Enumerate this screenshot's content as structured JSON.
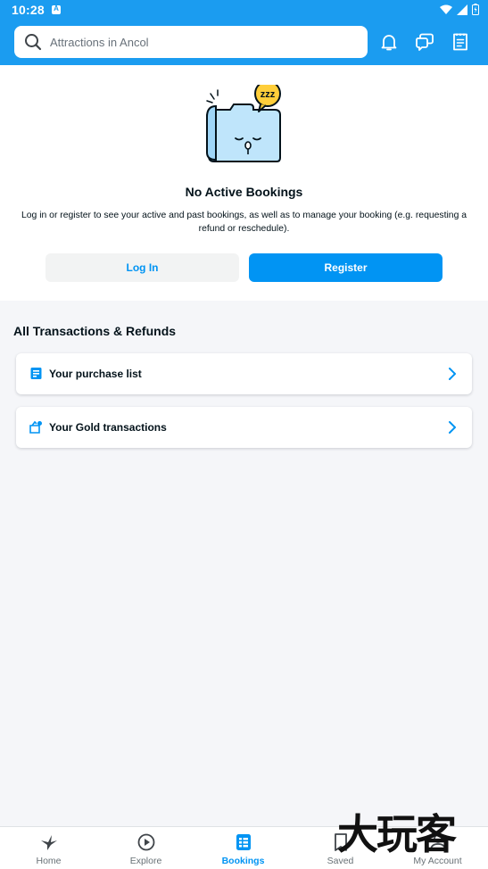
{
  "status_bar": {
    "time": "10:28",
    "notification_letter": "A"
  },
  "header": {
    "search_placeholder": "Attractions in Ancol",
    "icons": [
      "bell-icon",
      "chat-icon",
      "receipt-icon"
    ]
  },
  "colors": {
    "primary": "#0194f3",
    "header_bg": "#1b9cf0",
    "text": "#03121a",
    "muted": "#687176"
  },
  "empty_state": {
    "title": "No Active Bookings",
    "description": "Log in or register to see your active and past bookings, as well as to manage your booking (e.g. requesting a refund or reschedule).",
    "login_label": "Log In",
    "register_label": "Register"
  },
  "transactions": {
    "title": "All Transactions & Refunds",
    "items": [
      {
        "label": "Your purchase list",
        "icon": "purchase-list-icon"
      },
      {
        "label": "Your Gold transactions",
        "icon": "gold-icon"
      }
    ]
  },
  "bottom_nav": {
    "active": "Bookings",
    "items": [
      {
        "label": "Home",
        "icon": "bird-icon"
      },
      {
        "label": "Explore",
        "icon": "play-circle-icon"
      },
      {
        "label": "Bookings",
        "icon": "bookings-icon"
      },
      {
        "label": "Saved",
        "icon": "bookmark-icon"
      },
      {
        "label": "My Account",
        "icon": "person-icon"
      }
    ]
  },
  "watermark": "大玩客"
}
